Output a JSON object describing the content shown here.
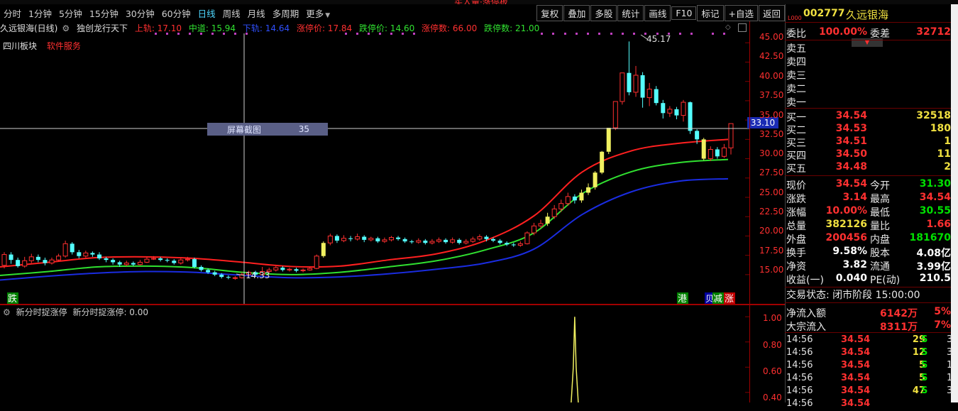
{
  "top_red_text": "买入量·涨停板",
  "toolbar": {
    "periods": [
      "分时",
      "1分钟",
      "5分钟",
      "15分钟",
      "30分钟",
      "60分钟",
      "日线",
      "周线",
      "月线",
      "多周期",
      "更多"
    ],
    "active_period": "日线",
    "buttons": [
      "复权",
      "叠加",
      "多股",
      "统计",
      "画线",
      "F10",
      "标记",
      "+自选",
      "返回"
    ]
  },
  "chart_header": {
    "stock_title": "久远银海(日线)",
    "indicator_name": "独创龙行天下",
    "upper_track": "上轨: 17.10",
    "middle_track": "中道: 15.94",
    "lower_track": "下轨: 14.64",
    "limit_up_price": "涨停价: 17.84",
    "limit_down_price": "跌停价: 14.60",
    "limit_up_count": "涨停数: 66.00",
    "limit_down_count": "跌停数: 21.00"
  },
  "sector": {
    "name": "四川板块",
    "service": "软件服务"
  },
  "popup": {
    "label": "屏幕截图",
    "value": "35"
  },
  "crosshair_price": "33.10",
  "high_label": "45.17",
  "low_label": "14.33",
  "markers": {
    "die": "跌",
    "gang": "港",
    "jian": "减",
    "zhang": "涨",
    "buy": "贝"
  },
  "y_axis": [
    "45.00",
    "42.50",
    "40.00",
    "37.50",
    "35.00",
    "32.50",
    "30.00",
    "27.50",
    "25.00",
    "22.50",
    "20.00",
    "17.50",
    "15.00"
  ],
  "lower_panel": {
    "title": "新分时捉涨停",
    "value_label": "新分时捉涨停: 0.00",
    "y_axis": [
      "1.00",
      "0.80",
      "0.60",
      "0.40"
    ]
  },
  "chart_data": {
    "type": "candlestick",
    "ylim": [
      12.6,
      46.4
    ],
    "candles": [
      {
        "o": 16.2,
        "c": 17.6,
        "h": 17.9,
        "l": 15.8
      },
      {
        "o": 17.6,
        "c": 16.9,
        "h": 17.9,
        "l": 16.4
      },
      {
        "o": 16.9,
        "c": 16.1,
        "h": 17.2,
        "l": 15.9
      },
      {
        "o": 16.1,
        "c": 16.8,
        "h": 17.3,
        "l": 15.9
      },
      {
        "o": 16.8,
        "c": 17.3,
        "h": 17.7,
        "l": 16.5
      },
      {
        "o": 17.3,
        "c": 16.9,
        "h": 17.6,
        "l": 16.6
      },
      {
        "o": 16.9,
        "c": 16.5,
        "h": 17.2,
        "l": 16.2
      },
      {
        "o": 16.5,
        "c": 16.9,
        "h": 17.2,
        "l": 16.3
      },
      {
        "o": 16.9,
        "c": 17.4,
        "h": 17.7,
        "l": 16.7
      },
      {
        "o": 17.4,
        "c": 19.0,
        "h": 19.4,
        "l": 17.2
      },
      {
        "o": 19.0,
        "c": 17.9,
        "h": 19.2,
        "l": 17.6
      },
      {
        "o": 17.9,
        "c": 17.4,
        "h": 18.2,
        "l": 17.1
      },
      {
        "o": 17.4,
        "c": 17.8,
        "h": 18.1,
        "l": 17.2
      },
      {
        "o": 17.8,
        "c": 17.6,
        "h": 18.0,
        "l": 17.3
      },
      {
        "o": 17.6,
        "c": 17.1,
        "h": 17.9,
        "l": 16.9
      },
      {
        "o": 17.1,
        "c": 16.9,
        "h": 17.3,
        "l": 16.6
      },
      {
        "o": 16.9,
        "c": 16.6,
        "h": 17.1,
        "l": 16.3
      },
      {
        "o": 16.6,
        "c": 16.3,
        "h": 16.8,
        "l": 16.0
      },
      {
        "o": 16.3,
        "c": 16.5,
        "h": 16.8,
        "l": 16.1
      },
      {
        "o": 16.5,
        "c": 16.3,
        "h": 16.7,
        "l": 16.1
      },
      {
        "o": 16.3,
        "c": 16.6,
        "h": 16.9,
        "l": 16.2
      },
      {
        "o": 16.6,
        "c": 17.0,
        "h": 17.3,
        "l": 16.5
      },
      {
        "o": 17.0,
        "c": 17.1,
        "h": 17.4,
        "l": 16.9
      },
      {
        "o": 17.1,
        "c": 16.9,
        "h": 17.3,
        "l": 16.7
      },
      {
        "o": 16.9,
        "c": 16.8,
        "h": 17.1,
        "l": 16.6
      },
      {
        "o": 16.8,
        "c": 16.5,
        "h": 17.0,
        "l": 16.3
      },
      {
        "o": 16.5,
        "c": 16.9,
        "h": 17.1,
        "l": 16.3
      },
      {
        "o": 16.9,
        "c": 17.0,
        "h": 17.3,
        "l": 16.7
      },
      {
        "o": 17.0,
        "c": 16.0,
        "h": 17.2,
        "l": 15.8
      },
      {
        "o": 16.0,
        "c": 15.6,
        "h": 16.2,
        "l": 15.4
      },
      {
        "o": 15.6,
        "c": 15.3,
        "h": 15.8,
        "l": 15.1
      },
      {
        "o": 15.3,
        "c": 15.0,
        "h": 15.5,
        "l": 14.8
      },
      {
        "o": 15.0,
        "c": 14.7,
        "h": 15.2,
        "l": 14.5
      },
      {
        "o": 14.7,
        "c": 14.6,
        "h": 14.9,
        "l": 14.4
      },
      {
        "o": 14.6,
        "c": 14.6,
        "h": 14.8,
        "l": 14.33
      },
      {
        "o": 14.6,
        "c": 15.0,
        "h": 15.3,
        "l": 14.5
      },
      {
        "o": 15.0,
        "c": 15.3,
        "h": 15.5,
        "l": 14.9
      },
      {
        "o": 15.3,
        "c": 15.0,
        "h": 15.5,
        "l": 14.8
      },
      {
        "o": 15.0,
        "c": 15.4,
        "h": 16.0,
        "l": 14.9
      },
      {
        "o": 15.4,
        "c": 15.6,
        "h": 15.9,
        "l": 15.2
      },
      {
        "o": 15.6,
        "c": 15.9,
        "h": 16.1,
        "l": 15.4
      },
      {
        "o": 15.9,
        "c": 15.6,
        "h": 16.1,
        "l": 15.4
      },
      {
        "o": 15.6,
        "c": 15.7,
        "h": 15.9,
        "l": 15.4
      },
      {
        "o": 15.7,
        "c": 15.5,
        "h": 15.9,
        "l": 15.3
      },
      {
        "o": 15.5,
        "c": 15.6,
        "h": 15.8,
        "l": 15.3
      },
      {
        "o": 15.6,
        "c": 15.8,
        "h": 16.0,
        "l": 15.5
      },
      {
        "o": 15.8,
        "c": 17.4,
        "h": 17.6,
        "l": 15.7
      },
      {
        "o": 17.4,
        "c": 19.1,
        "h": 19.3,
        "l": 17.2
      },
      {
        "o": 19.1,
        "c": 20.0,
        "h": 20.3,
        "l": 18.8
      },
      {
        "o": 20.0,
        "c": 19.4,
        "h": 20.2,
        "l": 19.1
      },
      {
        "o": 19.4,
        "c": 19.7,
        "h": 20.1,
        "l": 19.2
      },
      {
        "o": 19.7,
        "c": 19.6,
        "h": 20.0,
        "l": 19.3
      },
      {
        "o": 19.6,
        "c": 19.9,
        "h": 20.3,
        "l": 19.4
      },
      {
        "o": 19.9,
        "c": 19.5,
        "h": 20.1,
        "l": 19.2
      },
      {
        "o": 19.5,
        "c": 19.7,
        "h": 19.9,
        "l": 19.3
      },
      {
        "o": 19.7,
        "c": 19.3,
        "h": 19.9,
        "l": 19.1
      },
      {
        "o": 19.3,
        "c": 19.5,
        "h": 19.8,
        "l": 19.1
      },
      {
        "o": 19.5,
        "c": 19.8,
        "h": 20.0,
        "l": 19.3
      },
      {
        "o": 19.8,
        "c": 19.6,
        "h": 20.0,
        "l": 19.4
      },
      {
        "o": 19.6,
        "c": 19.3,
        "h": 19.8,
        "l": 19.1
      },
      {
        "o": 19.3,
        "c": 19.2,
        "h": 19.5,
        "l": 19.0
      },
      {
        "o": 19.2,
        "c": 19.4,
        "h": 19.7,
        "l": 19.0
      },
      {
        "o": 19.4,
        "c": 19.1,
        "h": 19.6,
        "l": 18.9
      },
      {
        "o": 19.1,
        "c": 19.3,
        "h": 19.6,
        "l": 18.9
      },
      {
        "o": 19.3,
        "c": 19.5,
        "h": 19.8,
        "l": 19.1
      },
      {
        "o": 19.5,
        "c": 19.2,
        "h": 19.7,
        "l": 19.0
      },
      {
        "o": 19.2,
        "c": 19.5,
        "h": 19.8,
        "l": 19.0
      },
      {
        "o": 19.5,
        "c": 19.1,
        "h": 19.7,
        "l": 18.9
      },
      {
        "o": 19.1,
        "c": 19.3,
        "h": 19.6,
        "l": 18.9
      },
      {
        "o": 19.3,
        "c": 19.6,
        "h": 19.9,
        "l": 19.1
      },
      {
        "o": 19.6,
        "c": 19.9,
        "h": 20.2,
        "l": 19.4
      },
      {
        "o": 19.9,
        "c": 19.6,
        "h": 20.1,
        "l": 19.3
      },
      {
        "o": 19.6,
        "c": 19.4,
        "h": 19.8,
        "l": 19.2
      },
      {
        "o": 19.4,
        "c": 19.1,
        "h": 19.6,
        "l": 18.9
      },
      {
        "o": 19.1,
        "c": 18.9,
        "h": 19.3,
        "l": 18.7
      },
      {
        "o": 18.9,
        "c": 18.8,
        "h": 19.1,
        "l": 18.6
      },
      {
        "o": 18.8,
        "c": 19.0,
        "h": 19.3,
        "l": 18.6
      },
      {
        "o": 19.0,
        "c": 20.4,
        "h": 20.6,
        "l": 18.9
      },
      {
        "o": 20.4,
        "c": 21.3,
        "h": 21.7,
        "l": 20.1
      },
      {
        "o": 21.3,
        "c": 21.6,
        "h": 22.1,
        "l": 21.0
      },
      {
        "o": 21.6,
        "c": 22.5,
        "h": 23.0,
        "l": 21.3
      },
      {
        "o": 22.5,
        "c": 23.5,
        "h": 24.0,
        "l": 22.2
      },
      {
        "o": 23.5,
        "c": 24.2,
        "h": 24.7,
        "l": 23.1
      },
      {
        "o": 24.2,
        "c": 25.1,
        "h": 25.6,
        "l": 23.9
      },
      {
        "o": 25.1,
        "c": 24.6,
        "h": 25.4,
        "l": 24.2
      },
      {
        "o": 24.6,
        "c": 25.6,
        "h": 26.0,
        "l": 24.3
      },
      {
        "o": 25.6,
        "c": 26.3,
        "h": 26.8,
        "l": 25.3
      },
      {
        "o": 26.3,
        "c": 28.2,
        "h": 28.4,
        "l": 26.0
      },
      {
        "o": 28.2,
        "c": 30.9,
        "h": 31.0,
        "l": 28.0
      },
      {
        "o": 30.9,
        "c": 34.0,
        "h": 34.0,
        "l": 30.6
      },
      {
        "o": 34.0,
        "c": 37.4,
        "h": 37.4,
        "l": 33.7
      },
      {
        "o": 37.4,
        "c": 41.1,
        "h": 41.1,
        "l": 37.0
      },
      {
        "o": 41.1,
        "c": 38.6,
        "h": 45.17,
        "l": 38.2
      },
      {
        "o": 38.6,
        "c": 40.8,
        "h": 42.0,
        "l": 38.0
      },
      {
        "o": 40.8,
        "c": 37.9,
        "h": 41.2,
        "l": 36.6
      },
      {
        "o": 37.9,
        "c": 39.0,
        "h": 39.8,
        "l": 36.8
      },
      {
        "o": 39.0,
        "c": 37.2,
        "h": 39.4,
        "l": 36.9
      },
      {
        "o": 37.2,
        "c": 35.9,
        "h": 37.6,
        "l": 35.2
      },
      {
        "o": 35.9,
        "c": 36.4,
        "h": 36.8,
        "l": 35.4
      },
      {
        "o": 36.4,
        "c": 35.6,
        "h": 36.7,
        "l": 35.1
      },
      {
        "o": 35.6,
        "c": 37.3,
        "h": 37.6,
        "l": 34.8
      },
      {
        "o": 37.3,
        "c": 33.6,
        "h": 37.4,
        "l": 33.2
      },
      {
        "o": 33.6,
        "c": 32.5,
        "h": 33.8,
        "l": 31.9
      },
      {
        "o": 32.5,
        "c": 30.0,
        "h": 32.7,
        "l": 29.8
      },
      {
        "o": 30.0,
        "c": 31.2,
        "h": 31.6,
        "l": 29.7
      },
      {
        "o": 31.2,
        "c": 30.3,
        "h": 31.5,
        "l": 30.0
      },
      {
        "o": 30.3,
        "c": 31.4,
        "h": 31.9,
        "l": 30.1
      },
      {
        "o": 31.4,
        "c": 34.54,
        "h": 34.54,
        "l": 30.55
      }
    ],
    "limit_up_indices": [
      47,
      80,
      85,
      86,
      87,
      88,
      89,
      103
    ],
    "bands": {
      "upper": [
        16.0,
        16.6,
        17.2,
        17.3,
        17.1,
        16.6,
        16.05,
        16.1,
        16.9,
        17.7,
        19.4,
        22.6,
        28.3,
        31.0,
        32.0,
        32.5
      ],
      "middle": [
        14.9,
        15.4,
        16.0,
        16.1,
        15.9,
        15.3,
        15.0,
        15.3,
        16.0,
        16.8,
        18.2,
        20.4,
        25.5,
        28.3,
        29.5,
        29.9
      ],
      "lower": [
        14.3,
        14.8,
        15.2,
        15.4,
        15.3,
        14.9,
        14.6,
        14.7,
        15.1,
        15.7,
        16.5,
        18.3,
        22.8,
        25.7,
        27.1,
        27.4
      ]
    },
    "lower_indicator": {
      "series": "新分时捉涨停",
      "ylim": [
        0.32,
        1.08
      ],
      "spike_index": 84,
      "spike_value": 1.0
    }
  },
  "quote": {
    "code": "002777",
    "name": "久远银海",
    "weibi_label": "委比",
    "weibi": "100.00%",
    "weicha_label": "委差",
    "weicha": "32712",
    "sell": [
      {
        "label": "卖五",
        "price": "",
        "vol": ""
      },
      {
        "label": "卖四",
        "price": "",
        "vol": ""
      },
      {
        "label": "卖三",
        "price": "",
        "vol": ""
      },
      {
        "label": "卖二",
        "price": "",
        "vol": ""
      },
      {
        "label": "卖一",
        "price": "",
        "vol": ""
      }
    ],
    "buy": [
      {
        "label": "买一",
        "price": "34.54",
        "vol": "32518"
      },
      {
        "label": "买二",
        "price": "34.53",
        "vol": "180"
      },
      {
        "label": "买三",
        "price": "34.51",
        "vol": "1"
      },
      {
        "label": "买四",
        "price": "34.50",
        "vol": "11"
      },
      {
        "label": "买五",
        "price": "34.48",
        "vol": "2"
      }
    ],
    "stats": [
      {
        "l1": "现价",
        "v1": "34.54",
        "c1": "red",
        "l2": "今开",
        "v2": "31.30",
        "c2": "grn"
      },
      {
        "l1": "涨跌",
        "v1": "3.14",
        "c1": "red",
        "l2": "最高",
        "v2": "34.54",
        "c2": "red"
      },
      {
        "l1": "涨幅",
        "v1": "10.00%",
        "c1": "red",
        "l2": "最低",
        "v2": "30.55",
        "c2": "grn"
      },
      {
        "l1": "总量",
        "v1": "382126",
        "c1": "yel",
        "l2": "量比",
        "v2": "1.66",
        "c2": "red"
      },
      {
        "l1": "外盘",
        "v1": "200456",
        "c1": "red",
        "l2": "内盘",
        "v2": "181670",
        "c2": "grn"
      },
      {
        "l1": "换手",
        "v1": "9.58%",
        "c1": "wht",
        "l2": "股本",
        "v2": "4.08亿",
        "c2": "wht"
      },
      {
        "l1": "净资",
        "v1": "3.82",
        "c1": "wht",
        "l2": "流通",
        "v2": "3.99亿",
        "c2": "wht"
      },
      {
        "l1": "收益(一)",
        "v1": "0.040",
        "c1": "wht",
        "l2": "PE(动)",
        "v2": "210.5",
        "c2": "wht"
      }
    ],
    "status_label": "交易状态: 闭市阶段 15:00:00",
    "flows": [
      {
        "label": "净流入额",
        "value": "6142万",
        "pct": "5%"
      },
      {
        "label": "大宗流入",
        "value": "8311万",
        "pct": "7%"
      }
    ],
    "ticks": [
      {
        "time": "14:56",
        "price": "34.54",
        "vol": "29",
        "side": "S",
        "n": "3"
      },
      {
        "time": "14:56",
        "price": "34.54",
        "vol": "12",
        "side": "S",
        "n": "3"
      },
      {
        "time": "14:56",
        "price": "34.54",
        "vol": "5",
        "side": "S",
        "n": "1"
      },
      {
        "time": "14:56",
        "price": "34.54",
        "vol": "5",
        "side": "S",
        "n": "1"
      },
      {
        "time": "14:56",
        "price": "34.54",
        "vol": "47",
        "side": "S",
        "n": "3"
      },
      {
        "time": "14:56",
        "price": "34.54",
        "vol": "",
        "side": "",
        "n": ""
      }
    ]
  },
  "colors": {
    "up": "#ff3030",
    "down": "#54ffff",
    "upper_band": "#ff2020",
    "middle_band": "#30e030",
    "lower_band": "#1a2ce0",
    "limit": "#f0f060",
    "grid_red": "#800000"
  }
}
